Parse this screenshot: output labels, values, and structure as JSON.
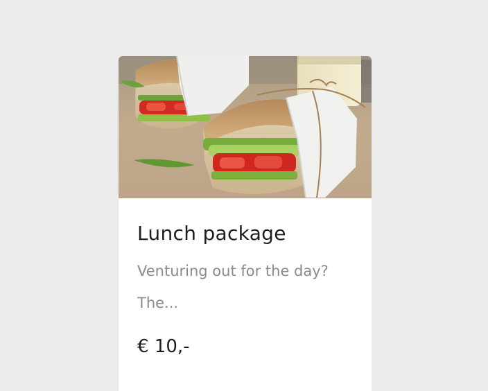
{
  "product": {
    "image_subject": "sandwich-photo",
    "title": "Lunch package",
    "description": "Venturing out for the day? The...",
    "price": "€ 10,-"
  },
  "colors": {
    "background": "#ebebeb",
    "card": "#ffffff",
    "title": "#1d1d1d",
    "description": "#8a8a8a"
  }
}
